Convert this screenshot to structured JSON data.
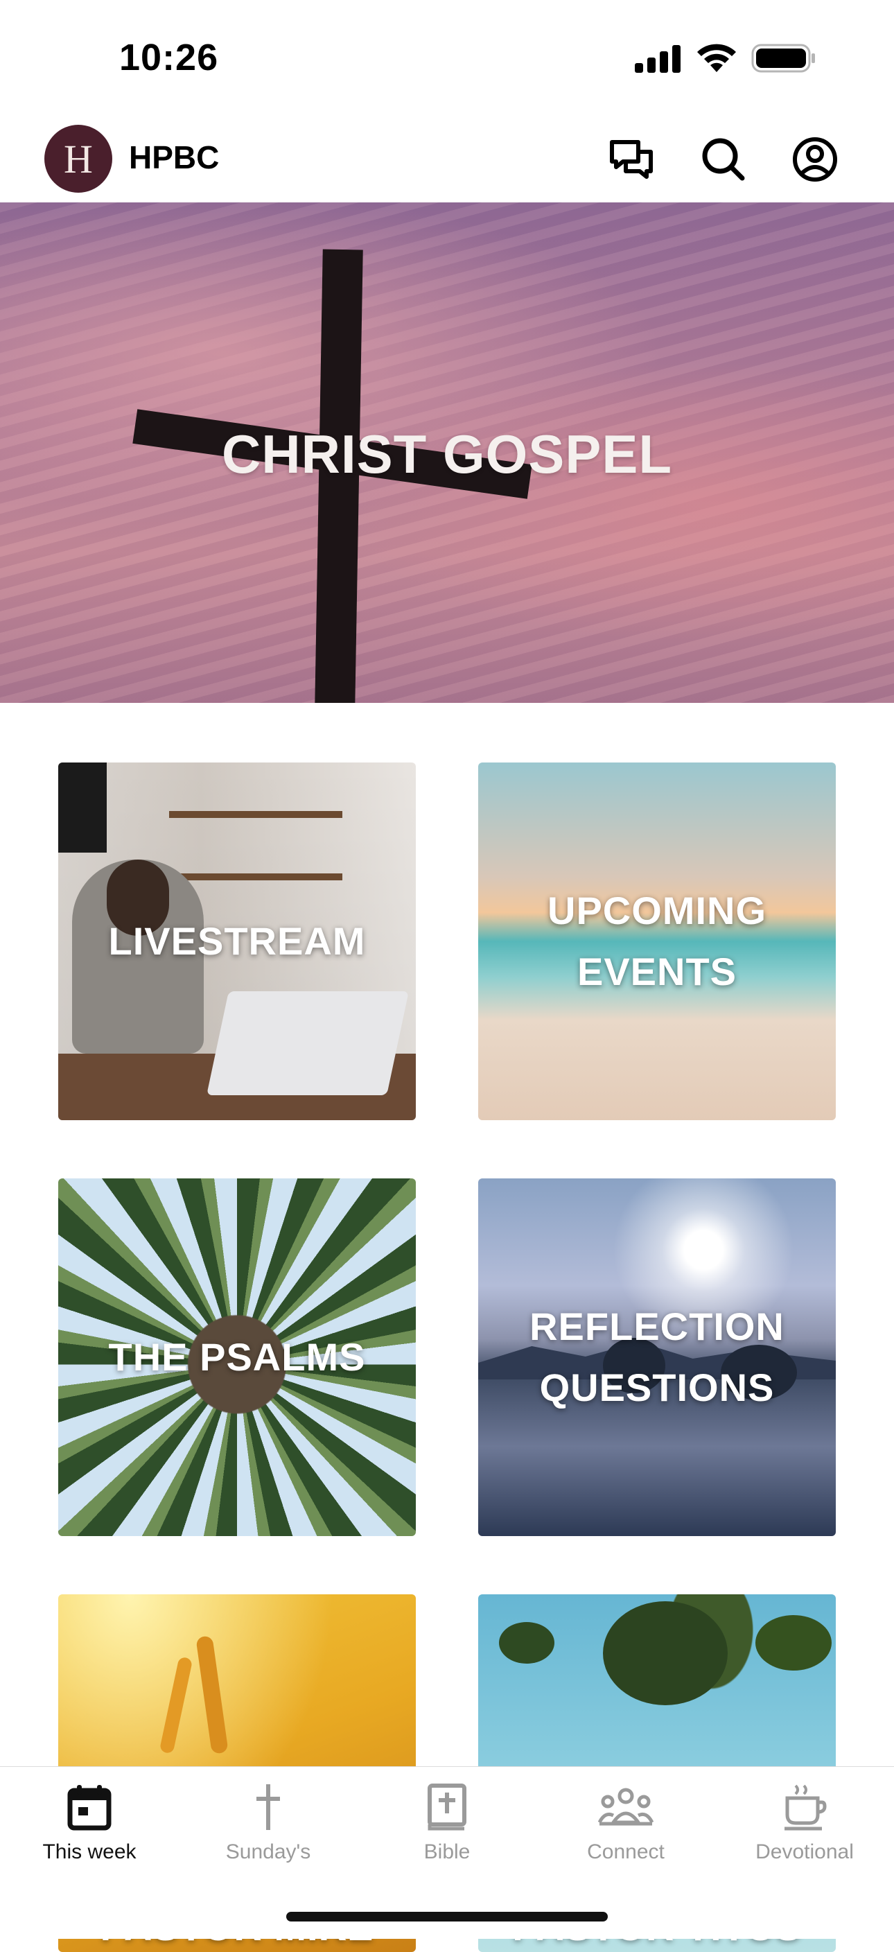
{
  "status_bar": {
    "time": "10:26"
  },
  "header": {
    "logo_letter": "H",
    "title": "HPBC"
  },
  "hero": {
    "title": "CHRIST GOSPEL",
    "slide_count": 4,
    "active_slide": 1
  },
  "tiles": [
    {
      "label": "LIVESTREAM"
    },
    {
      "label": "UPCOMING EVENTS"
    },
    {
      "label": "THE PSALMS"
    },
    {
      "label": "REFLECTION QUESTIONS"
    },
    {
      "label": "PASTOR MIKE"
    },
    {
      "label": "PASTOR TITUS"
    }
  ],
  "tabs": [
    {
      "label": "This week",
      "icon": "calendar-icon",
      "active": true
    },
    {
      "label": "Sunday's",
      "icon": "cross-icon",
      "active": false
    },
    {
      "label": "Bible",
      "icon": "bible-icon",
      "active": false
    },
    {
      "label": "Connect",
      "icon": "people-icon",
      "active": false
    },
    {
      "label": "Devotional",
      "icon": "coffee-cup-icon",
      "active": false
    }
  ],
  "colors": {
    "logo_bg": "#4a1f2c",
    "active_tab": "#111111",
    "inactive_tab": "#9a9a9a"
  }
}
